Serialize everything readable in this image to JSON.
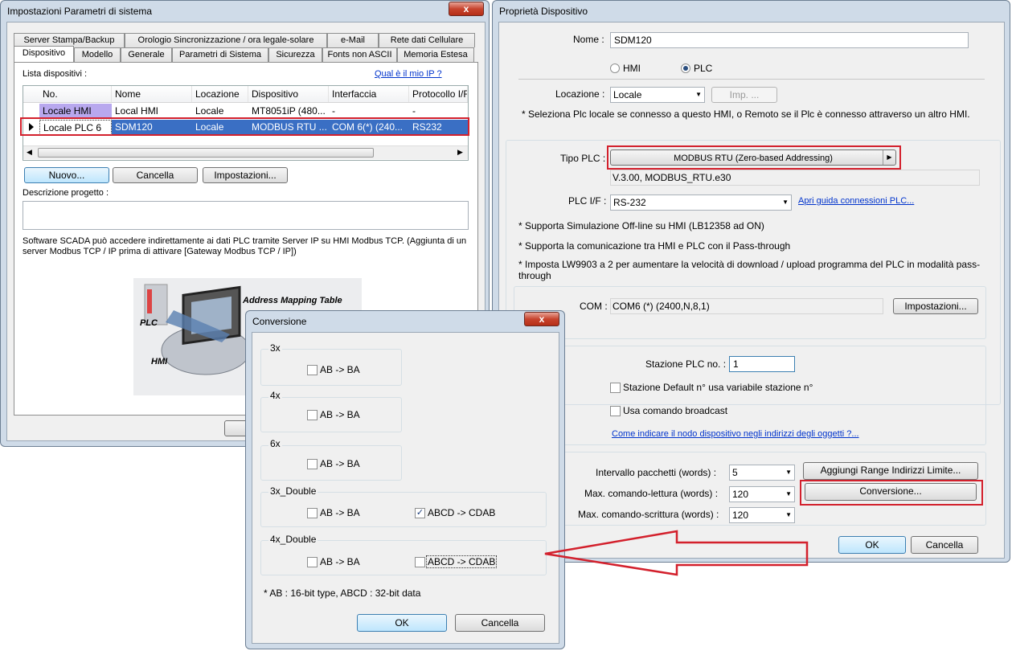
{
  "system_params": {
    "title": "Impostazioni Parametri di sistema",
    "close": "x",
    "tabs_row1": [
      "Server Stampa/Backup",
      "Orologio Sincronizzazione / ora legale-solare",
      "e-Mail",
      "Rete dati Cellulare"
    ],
    "tabs_row2": [
      "Dispositivo",
      "Modello",
      "Generale",
      "Parametri di Sistema",
      "Sicurezza",
      "Fonts non ASCII",
      "Memoria Estesa"
    ],
    "device_list_label": "Lista dispositivi :",
    "ip_link": "Qual è il mio IP ?",
    "columns": [
      "No.",
      "Nome",
      "Locazione",
      "Dispositivo",
      "Interfaccia",
      "Protocollo I/F"
    ],
    "rows": [
      {
        "no": "Locale HMI",
        "nome": "Local HMI",
        "locazione": "Locale",
        "dispositivo": "MT8051iP (480...",
        "interfaccia": "-",
        "protocollo": "-"
      },
      {
        "no": "Locale PLC 6",
        "nome": "SDM120",
        "locazione": "Locale",
        "dispositivo": "MODBUS RTU ...",
        "interfaccia": "COM 6(*)  (240...",
        "protocollo": "RS232"
      }
    ],
    "btn_new": "Nuovo...",
    "btn_delete": "Cancella",
    "btn_settings": "Impostazioni...",
    "desc_label": "Descrizione progetto :",
    "scada_note": "Software SCADA può accedere indirettamente ai dati PLC tramite Server IP su HMI Modbus TCP. (Aggiunta di un server Modbus TCP / IP prima di attivare [Gateway Modbus TCP / IP])",
    "diagram": {
      "title": "Address Mapping Table",
      "plc": "PLC",
      "hmi": "HMI"
    }
  },
  "device_props": {
    "title": "Proprietà Dispositivo",
    "name_label": "Nome :",
    "name_value": "SDM120",
    "radio_hmi": "HMI",
    "radio_plc": "PLC",
    "location_label": "Locazione :",
    "location_value": "Locale",
    "imp_btn": "Imp. ...",
    "location_note": "* Seleziona Plc locale se connesso a questo HMI, o Remoto se il Plc è connesso attraverso un altro HMI.",
    "plc_type_label": "Tipo PLC :",
    "plc_type_value": "MODBUS RTU (Zero-based Addressing)",
    "version": "V.3.00, MODBUS_RTU.e30",
    "plc_if_label": "PLC I/F :",
    "plc_if_value": "RS-232",
    "plc_guide_link": "Apri guida connessioni PLC...",
    "note1": "* Supporta Simulazione Off-line su HMI (LB12358 ad ON)",
    "note2": "* Supporta la comunicazione tra HMI e PLC con il Pass-through",
    "note3": "* Imposta LW9903 a 2 per aumentare la velocità di download / upload programma del PLC in modalità pass-through",
    "com_label": "COM :",
    "com_value": "COM6 (*) (2400,N,8,1)",
    "com_settings_btn": "Impostazioni...",
    "station_label": "Stazione PLC no. :",
    "station_value": "1",
    "default_station": "Stazione Default n° usa variabile stazione n°",
    "broadcast": "Usa comando broadcast",
    "node_link": "Come indicare il nodo dispositivo negli indirizzi degli oggetti ?...",
    "interval_label": "Intervallo pacchetti (words) :",
    "interval_value": "5",
    "add_range_btn": "Aggiungi Range Indirizzi Limite...",
    "max_read_label": "Max. comando-lettura (words) :",
    "max_read_value": "120",
    "conversion_btn": "Conversione...",
    "max_write_label": "Max. comando-scrittura (words) :",
    "max_write_value": "120",
    "ok": "OK",
    "cancel": "Cancella"
  },
  "conversion": {
    "title": "Conversione",
    "groups": [
      {
        "name": "3x",
        "ab": "AB -> BA",
        "ab_checked": false
      },
      {
        "name": "4x",
        "ab": "AB -> BA",
        "ab_checked": false
      },
      {
        "name": "6x",
        "ab": "AB -> BA",
        "ab_checked": false
      },
      {
        "name": "3x_Double",
        "ab": "AB -> BA",
        "ab_checked": false,
        "abcd": "ABCD -> CDAB",
        "abcd_checked": true
      },
      {
        "name": "4x_Double",
        "ab": "AB -> BA",
        "ab_checked": false,
        "abcd": "ABCD -> CDAB",
        "abcd_checked": false
      }
    ],
    "note": "* AB : 16-bit type, ABCD : 32-bit data",
    "ok": "OK",
    "cancel": "Cancella"
  },
  "colors": {
    "highlight_red": "#d3202c",
    "selection_blue": "#3a6fc4",
    "title_bar": "#cfdbe8"
  }
}
